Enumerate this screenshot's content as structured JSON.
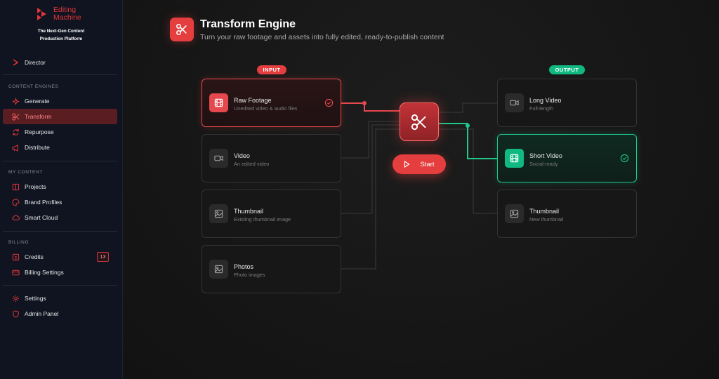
{
  "brand": {
    "name_line1": "Editing",
    "name_line2": "Machine",
    "tagline_line1": "The Next-Gen Content",
    "tagline_line2": "Production Platform"
  },
  "sidebar": {
    "director": {
      "label": "Director",
      "icon": "play-arrow-icon"
    },
    "sections": {
      "content_engines": "CONTENT ENGINES",
      "my_content": "MY CONTENT",
      "billing": "BILLING"
    },
    "content_engines": [
      {
        "label": "Generate",
        "icon": "sparkles-icon"
      },
      {
        "label": "Transform",
        "icon": "scissors-icon",
        "active": true
      },
      {
        "label": "Repurpose",
        "icon": "refresh-icon"
      },
      {
        "label": "Distribute",
        "icon": "megaphone-icon"
      }
    ],
    "my_content": [
      {
        "label": "Projects",
        "icon": "columns-icon"
      },
      {
        "label": "Brand Profiles",
        "icon": "palette-icon"
      },
      {
        "label": "Smart Cloud",
        "icon": "cloud-icon"
      }
    ],
    "billing": [
      {
        "label": "Credits",
        "icon": "dollar-icon",
        "badge": "13"
      },
      {
        "label": "Billing Settings",
        "icon": "card-icon"
      }
    ],
    "bottom": [
      {
        "label": "Settings",
        "icon": "gear-icon"
      },
      {
        "label": "Admin Panel",
        "icon": "shield-icon"
      }
    ]
  },
  "header": {
    "title": "Transform Engine",
    "subtitle": "Turn your raw footage and assets into fully edited, ready-to-publish content"
  },
  "flow": {
    "input_label": "INPUT",
    "output_label": "OUTPUT",
    "start_label": "Start",
    "inputs": [
      {
        "title": "Raw Footage",
        "subtitle": "Unedited video & audio files",
        "icon": "film-icon",
        "selected": true
      },
      {
        "title": "Video",
        "subtitle": "An edited video",
        "icon": "video-camera-icon",
        "selected": false
      },
      {
        "title": "Thumbnail",
        "subtitle": "Existing thumbnail image",
        "icon": "image-icon",
        "selected": false
      },
      {
        "title": "Photos",
        "subtitle": "Photo images",
        "icon": "image-icon",
        "selected": false
      }
    ],
    "outputs": [
      {
        "title": "Long Video",
        "subtitle": "Full-length",
        "icon": "video-camera-icon",
        "selected": false
      },
      {
        "title": "Short Video",
        "subtitle": "Social-ready",
        "icon": "film-icon",
        "selected": true
      },
      {
        "title": "Thumbnail",
        "subtitle": "New thumbnail",
        "icon": "image-icon",
        "selected": false
      }
    ]
  },
  "colors": {
    "accent_red": "#e53e3e",
    "accent_green": "#10b981",
    "sidebar_bg": "#0f1420",
    "main_bg": "#161616"
  }
}
